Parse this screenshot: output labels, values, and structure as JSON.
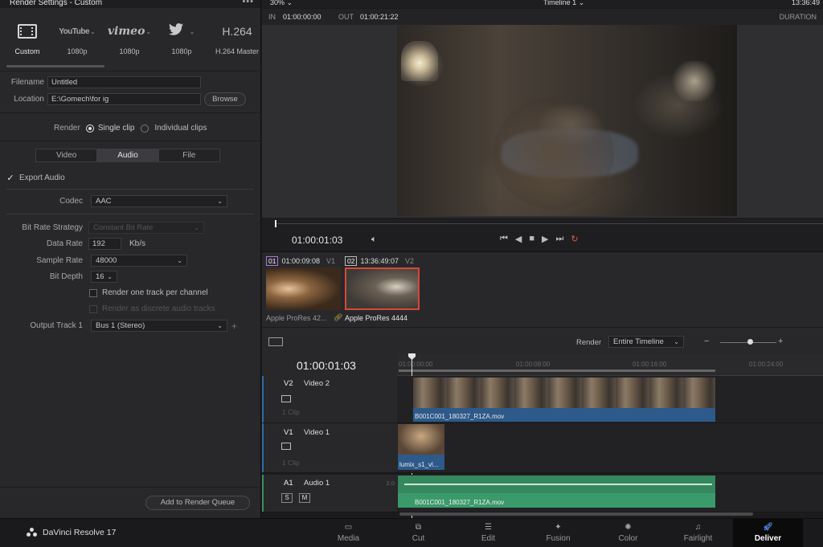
{
  "render_panel": {
    "title": "Render Settings - Custom",
    "presets": [
      {
        "icon": "film-icon",
        "label": "Custom"
      },
      {
        "icon": "youtube-logo",
        "logo": "YouTube",
        "label": "1080p"
      },
      {
        "icon": "vimeo-logo",
        "logo": "vimeo",
        "label": "1080p"
      },
      {
        "icon": "twitter-bird-icon",
        "logo": "🐦",
        "label": "1080p"
      },
      {
        "icon": "h264-logo",
        "logo": "H.264",
        "label": "H.264 Master"
      }
    ],
    "filename_label": "Filename",
    "filename_value": "Untitled",
    "location_label": "Location",
    "location_value": "E:\\Gomech\\for ig",
    "browse_label": "Browse",
    "render_label": "Render",
    "single_clip_label": "Single clip",
    "individual_clips_label": "Individual clips",
    "tabs": [
      "Video",
      "Audio",
      "File"
    ],
    "export_audio_label": "Export Audio",
    "codec_label": "Codec",
    "codec_value": "AAC",
    "bitrate_strategy_label": "Bit Rate Strategy",
    "bitrate_strategy_value": "Constant Bit Rate",
    "data_rate_label": "Data Rate",
    "data_rate_value": "192",
    "data_rate_unit": "Kb/s",
    "sample_rate_label": "Sample Rate",
    "sample_rate_value": "48000",
    "bit_depth_label": "Bit Depth",
    "bit_depth_value": "16",
    "one_track_label": "Render one track per channel",
    "discrete_label": "Render as discrete audio tracks",
    "output_track_label": "Output Track 1",
    "output_track_value": "Bus 1 (Stereo)",
    "add_queue_label": "Add to Render Queue"
  },
  "viewer": {
    "zoom": "30%",
    "timeline_name": "Timeline 1",
    "top_timecode": "13:36:49",
    "in_label": "IN",
    "in_value": "01:00:00:00",
    "out_label": "OUT",
    "out_value": "01:00:21:22",
    "duration_label": "DURATION",
    "current_timecode": "01:00:01:03"
  },
  "clips": [
    {
      "num": "01",
      "tc": "01:00:09:08",
      "track": "V1",
      "name": "Apple ProRes 42..."
    },
    {
      "num": "02",
      "tc": "13:36:49:07",
      "track": "V2",
      "name": "Apple ProRes 4444"
    }
  ],
  "timeline_bar": {
    "render_label": "Render",
    "render_value": "Entire Timeline"
  },
  "timeline": {
    "timecode": "01:00:01:03",
    "ruler_labels": [
      "01:00:00:00",
      "01:00:08:00",
      "01:00:16:00",
      "01:00:24:00"
    ],
    "tracks": [
      {
        "id": "V2",
        "name": "Video 2",
        "count": "1 Clip"
      },
      {
        "id": "V1",
        "name": "Video 1",
        "count": "1 Clip"
      },
      {
        "id": "A1",
        "name": "Audio 1",
        "level": "2.0"
      }
    ],
    "v2_clip_name": "B001C001_180327_R1ZA.mov",
    "v1_clip_name": "lumix_s1_vl...",
    "a1_clip_name": "B001C001_180327_R1ZA.mov",
    "solo_label": "S",
    "mute_label": "M"
  },
  "bottom_nav": {
    "brand": "DaVinci Resolve 17",
    "pages": [
      "Media",
      "Cut",
      "Edit",
      "Fusion",
      "Color",
      "Fairlight",
      "Deliver"
    ],
    "active": "Deliver"
  }
}
